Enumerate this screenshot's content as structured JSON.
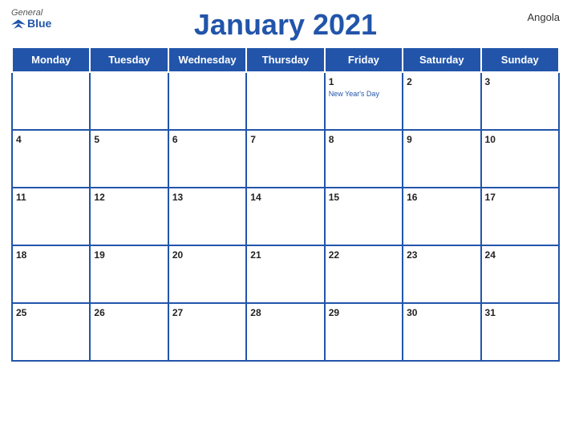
{
  "logo": {
    "general": "General",
    "blue": "Blue"
  },
  "header": {
    "title": "January 2021",
    "country": "Angola"
  },
  "days_of_week": [
    "Monday",
    "Tuesday",
    "Wednesday",
    "Thursday",
    "Friday",
    "Saturday",
    "Sunday"
  ],
  "weeks": [
    [
      {
        "num": "",
        "empty": true
      },
      {
        "num": "",
        "empty": true
      },
      {
        "num": "",
        "empty": true
      },
      {
        "num": "",
        "empty": true
      },
      {
        "num": "1",
        "holiday": "New Year's Day"
      },
      {
        "num": "2"
      },
      {
        "num": "3"
      }
    ],
    [
      {
        "num": "4"
      },
      {
        "num": "5"
      },
      {
        "num": "6"
      },
      {
        "num": "7"
      },
      {
        "num": "8"
      },
      {
        "num": "9"
      },
      {
        "num": "10"
      }
    ],
    [
      {
        "num": "11"
      },
      {
        "num": "12"
      },
      {
        "num": "13"
      },
      {
        "num": "14"
      },
      {
        "num": "15"
      },
      {
        "num": "16"
      },
      {
        "num": "17"
      }
    ],
    [
      {
        "num": "18"
      },
      {
        "num": "19"
      },
      {
        "num": "20"
      },
      {
        "num": "21"
      },
      {
        "num": "22"
      },
      {
        "num": "23"
      },
      {
        "num": "24"
      }
    ],
    [
      {
        "num": "25"
      },
      {
        "num": "26"
      },
      {
        "num": "27"
      },
      {
        "num": "28"
      },
      {
        "num": "29"
      },
      {
        "num": "30"
      },
      {
        "num": "31"
      }
    ]
  ]
}
